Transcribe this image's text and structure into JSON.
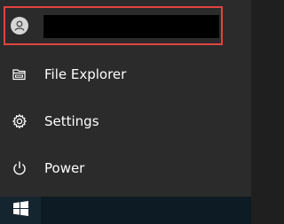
{
  "account": {
    "icon": "user-avatar-icon",
    "highlight_color": "#e0443e"
  },
  "menu": {
    "items": [
      {
        "label": "File Explorer",
        "icon": "folder-explorer-icon"
      },
      {
        "label": "Settings",
        "icon": "gear-icon"
      },
      {
        "label": "Power",
        "icon": "power-icon"
      }
    ]
  },
  "taskbar": {
    "start_icon": "windows-logo-icon"
  }
}
